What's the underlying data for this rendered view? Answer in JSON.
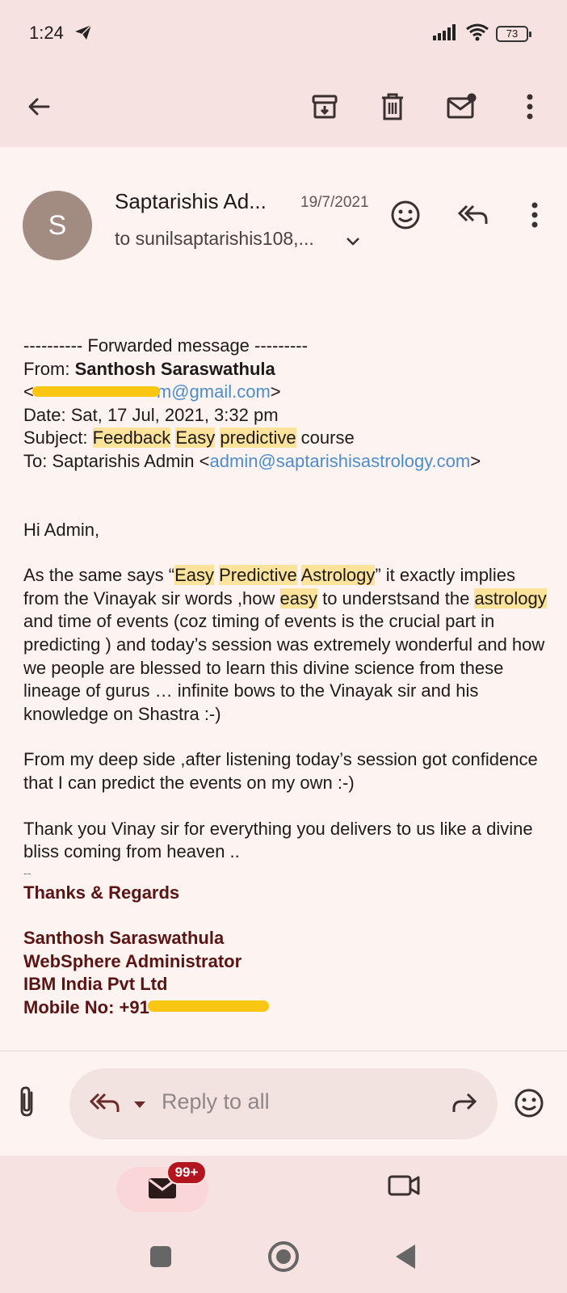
{
  "status_bar": {
    "time": "1:24",
    "battery": "73"
  },
  "toolbar": {
    "icons": [
      "back-arrow-icon",
      "archive-icon",
      "delete-icon",
      "mark-unread-icon",
      "more-vert-icon"
    ]
  },
  "email": {
    "avatar_letter": "S",
    "sender": "Saptarishis Ad...",
    "date": "19/7/2021",
    "recipients": "to sunilsaptarishis108,..."
  },
  "body": {
    "forward_header": "---------- Forwarded message ---------",
    "from_label": "From: ",
    "from_name": "Santhosh Saraswathula",
    "from_email_open": "<",
    "from_email_visible": "m@gmail.com",
    "from_email_close": ">",
    "date_line": "Date: Sat, 17 Jul, 2021, 3:32 pm",
    "subject_label": "Subject: ",
    "subject_w1": "Feedback",
    "subject_w2": "Easy",
    "subject_w3": "predictive",
    "subject_rest": " course",
    "to_label": "To: Saptarishis Admin <",
    "to_email": "admin@saptarishisastrology.com",
    "to_close": ">",
    "greeting": "Hi Admin,",
    "p1_a": "As the same says “",
    "p1_hl1": "Easy",
    "p1_hl2": "Predictive",
    "p1_hl3": "Astrology",
    "p1_b": "” it exactly implies from the Vinayak sir words ,how ",
    "p1_hl4": "easy",
    "p1_c": " to understsand the ",
    "p1_hl5": "astrology",
    "p1_d": " and time of events (coz timing of events is the crucial part in predicting ) and today’s session was extremely wonderful and how we people are blessed to learn this divine science from these lineage of gurus … infinite bows to the Vinayak sir and his knowledge on Shastra :-)",
    "p2": "From my deep side ,after listening today’s session got confidence that I can predict the events on my own :-)",
    "p3": "Thank you Vinay sir for everything you delivers to us like a divine bliss coming from heaven ..",
    "sig_dashes": "--",
    "sig_thanks": "Thanks & Regards",
    "sig_name": "Santhosh Saraswathula",
    "sig_title": "WebSphere Administrator",
    "sig_company": "IBM India Pvt Ltd",
    "sig_mobile": "Mobile No: +91"
  },
  "reply_bar": {
    "placeholder": "Reply to all"
  },
  "bottom_nav": {
    "badge": "99+"
  }
}
